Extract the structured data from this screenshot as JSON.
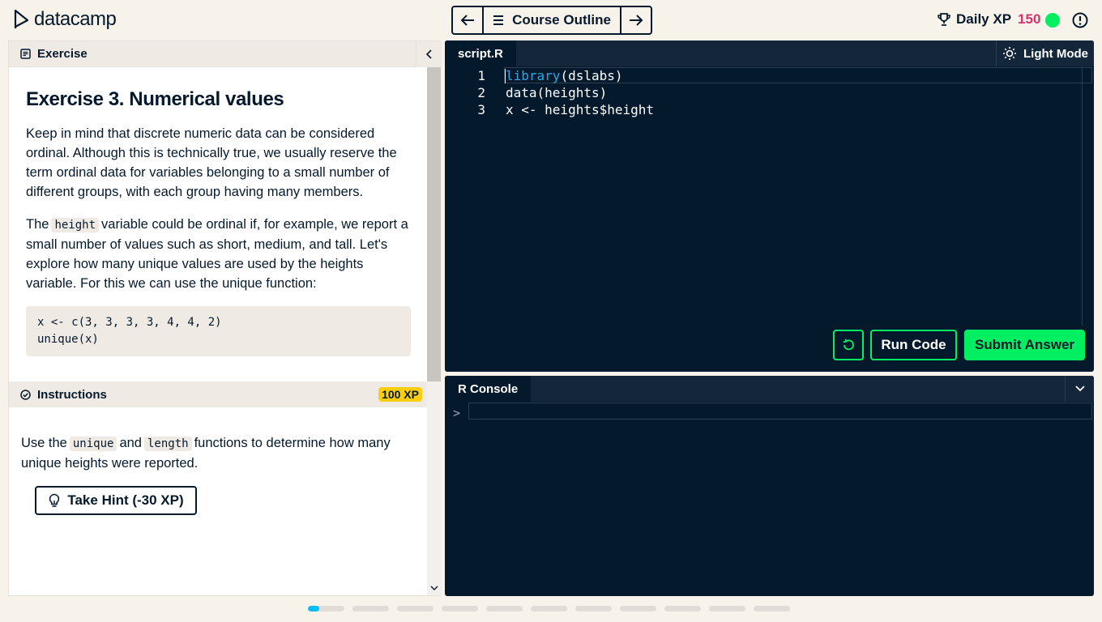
{
  "header": {
    "logo_text": "datacamp",
    "course_outline_label": "Course Outline",
    "daily_xp_label": "Daily XP",
    "daily_xp_value": "150"
  },
  "exercise_panel": {
    "tab_label": "Exercise",
    "title": "Exercise 3. Numerical values",
    "para1": "Keep in mind that discrete numeric data can be considered ordinal. Although this is technically true, we usually reserve the term ordinal data for variables belonging to a small number of different groups, with each group having many members.",
    "para2_before": "The",
    "para2_code": "height",
    "para2_after": "variable could be ordinal if, for example, we report a small number of values such as short, medium, and tall. Let's explore how many unique values are used by the heights variable. For this we can use the unique function:",
    "code_block": "x <- c(3, 3, 3, 3, 4, 4, 2)\nunique(x)"
  },
  "instructions": {
    "tab_label": "Instructions",
    "xp_badge": "100 XP",
    "text_before": "Use the",
    "code1": "unique",
    "text_mid": "and",
    "code2": "length",
    "text_after": "functions to determine how many unique heights were reported.",
    "hint_label": "Take Hint (-30 XP)"
  },
  "editor": {
    "tab_label": "script.R",
    "light_mode_label": "Light Mode",
    "lines": [
      {
        "num": "1",
        "kw": "library",
        "rest": "(dslabs)"
      },
      {
        "num": "2",
        "kw": "",
        "rest": "data(heights)"
      },
      {
        "num": "3",
        "kw": "",
        "rest": "x <- heights$height"
      }
    ],
    "run_label": "Run Code",
    "submit_label": "Submit Answer"
  },
  "console": {
    "tab_label": "R Console",
    "prompt": ">"
  },
  "progress": {
    "total": 11,
    "current_index": 0,
    "current_fill": 0.3
  },
  "colors": {
    "brand_green": "#03ef62",
    "navy": "#05192d",
    "xp_pink": "#d6336c",
    "badge_yellow": "#fcce0d",
    "progress_blue": "#06bdfc"
  }
}
